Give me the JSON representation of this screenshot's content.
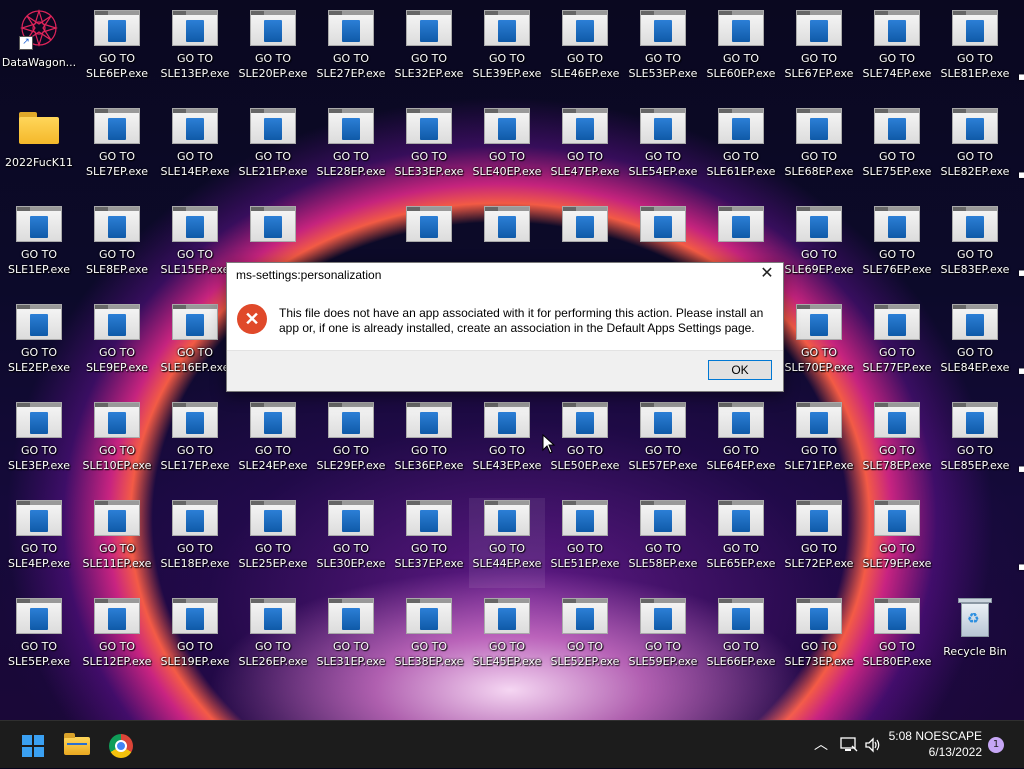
{
  "desktop": {
    "shortcut": {
      "label": "DataWagon..."
    },
    "folder": {
      "label": "2022FucK11"
    },
    "recycle_bin": {
      "label": "Recycle Bin"
    },
    "exe_prefix": "GO TO",
    "exe_icons": [
      "SLE1EP.exe",
      "SLE2EP.exe",
      "SLE3EP.exe",
      "SLE4EP.exe",
      "SLE5EP.exe",
      "SLE6EP.exe",
      "SLE7EP.exe",
      "SLE8EP.exe",
      "SLE9EP.exe",
      "SLE10EP.exe",
      "SLE11EP.exe",
      "SLE12EP.exe",
      "SLE13EP.exe",
      "SLE14EP.exe",
      "SLE15EP.exe",
      "SLE16EP.exe",
      "SLE17EP.exe",
      "SLE18EP.exe",
      "SLE19EP.exe",
      "SLE20EP.exe",
      "SLE21EP.exe",
      "SLE24EP.exe",
      "SLE25EP.exe",
      "SLE26EP.exe",
      "SLE27EP.exe",
      "SLE28EP.exe",
      "SLE29EP.exe",
      "SLE30EP.exe",
      "SLE31EP.exe",
      "SLE32EP.exe",
      "SLE33EP.exe",
      "SLE36EP.exe",
      "SLE37EP.exe",
      "SLE38EP.exe",
      "SLE39EP.exe",
      "SLE40EP.exe",
      "SLE43EP.exe",
      "SLE44EP.exe",
      "SLE45EP.exe",
      "SLE46EP.exe",
      "SLE47EP.exe",
      "SLE50EP.exe",
      "SLE51EP.exe",
      "SLE52EP.exe",
      "SLE53EP.exe",
      "SLE54EP.exe",
      "SLE57EP.exe",
      "SLE58EP.exe",
      "SLE59EP.exe",
      "SLE60EP.exe",
      "SLE61EP.exe",
      "SLE64EP.exe",
      "SLE65EP.exe",
      "SLE66EP.exe",
      "SLE67EP.exe",
      "SLE68EP.exe",
      "SLE69EP.exe",
      "SLE70EP.exe",
      "SLE71EP.exe",
      "SLE72EP.exe",
      "SLE73EP.exe",
      "SLE74EP.exe",
      "SLE75EP.exe",
      "SLE76EP.exe",
      "SLE77EP.exe",
      "SLE78EP.exe",
      "SLE79EP.exe",
      "SLE80EP.exe",
      "SLE81EP.exe",
      "SLE82EP.exe",
      "SLE83EP.exe",
      "SLE84EP.exe",
      "SLE85EP.exe"
    ],
    "selected_icon": "SLE44EP.exe"
  },
  "dialog": {
    "title": "ms-settings:personalization",
    "message": "This file does not have an app associated with it for performing this action. Please install an app or, if one is already installed, create an association in the Default Apps Settings page.",
    "ok_label": "OK",
    "error_glyph": "✕",
    "close_glyph": "✕"
  },
  "taskbar": {
    "pinned": [
      "start-icon",
      "file-explorer-icon",
      "chrome-icon"
    ],
    "tray_chevron": "︿",
    "clock_time": "5:08 NOESCAPE",
    "clock_date": "6/13/2022",
    "notification_count": "1"
  },
  "colors": {
    "accent": "#0078d4",
    "error": "#e0492a",
    "taskbar": "#1c1c1c",
    "badge": "#c6a6f5"
  }
}
